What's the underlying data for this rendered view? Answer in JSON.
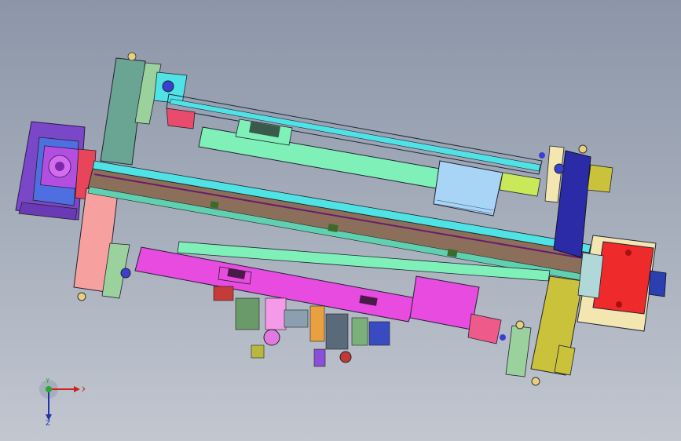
{
  "viewport": {
    "background_top": "#8c96a8",
    "background_bottom": "#c2c7d0"
  },
  "model": {
    "description_colors": {
      "frame_green": "#5fa89a",
      "rail_cyan": "#4fe3e6",
      "mint": "#7ef0b8",
      "magenta": "#e84be0",
      "salmon": "#f49a9a",
      "purple": "#8a4fd8",
      "navy": "#2b2ba8",
      "olive": "#c9c23a",
      "red": "#ee2a2a",
      "pale_blue": "#a8d4f5",
      "beige": "#f3e6b0"
    }
  },
  "triad": {
    "x_label": "X",
    "y_label": "Y",
    "z_label": "Z"
  }
}
